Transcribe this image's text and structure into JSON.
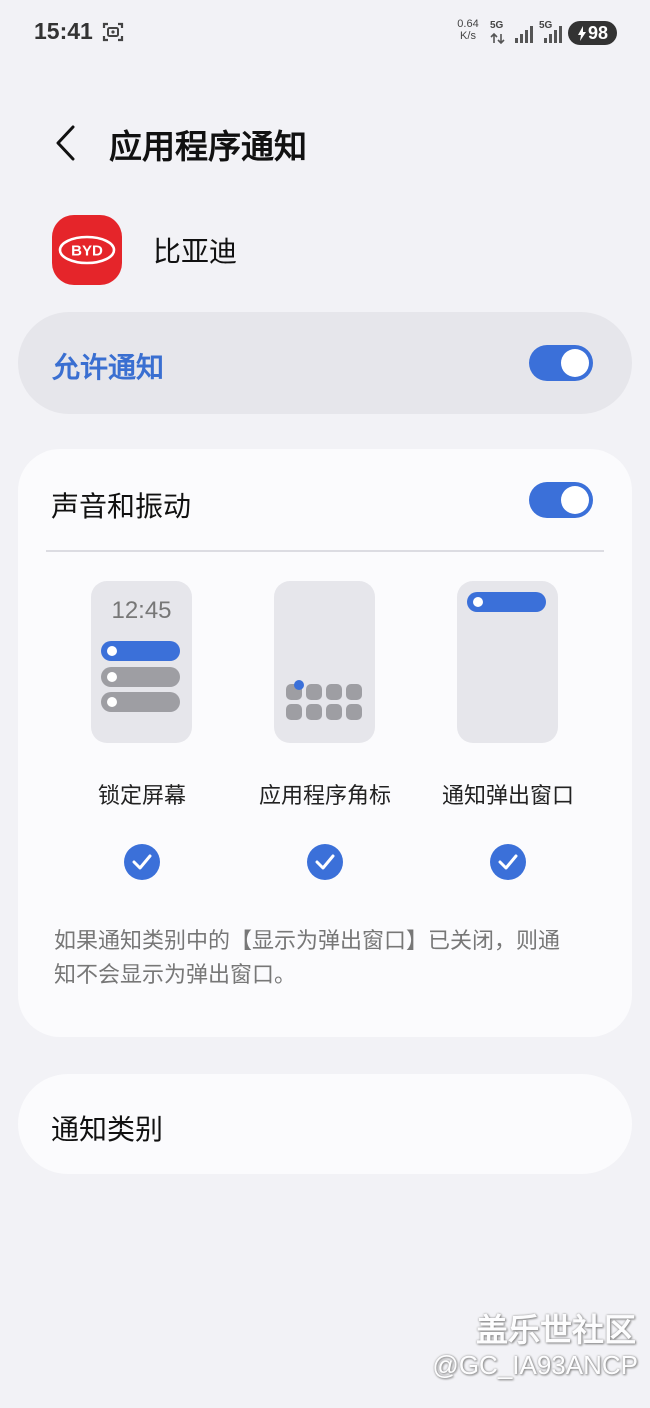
{
  "status_bar": {
    "time": "15:41",
    "net_speed_value": "0.64",
    "net_speed_unit": "K/s",
    "network_type_1": "5G",
    "network_type_2": "5G",
    "battery": "98"
  },
  "header": {
    "title": "应用程序通知"
  },
  "app": {
    "name": "比亚迪",
    "icon": "byd-logo",
    "icon_text": "BYD",
    "brand_color": "#e5252a"
  },
  "allow_notifications": {
    "label": "允许通知",
    "enabled": true,
    "accent_color": "#3b70d9"
  },
  "sound_vibration": {
    "label": "声音和振动",
    "enabled": true,
    "preview_time": "12:45",
    "options": [
      {
        "label": "锁定屏幕",
        "checked": true
      },
      {
        "label": "应用程序角标",
        "checked": true
      },
      {
        "label": "通知弹出窗口",
        "checked": true
      }
    ],
    "info": "如果通知类别中的【显示为弹出窗口】已关闭，则通知不会显示为弹出窗口。"
  },
  "categories": {
    "label": "通知类别"
  },
  "watermark": {
    "main": "盖乐世社区",
    "sub": "@GC_IA93ANCP"
  }
}
